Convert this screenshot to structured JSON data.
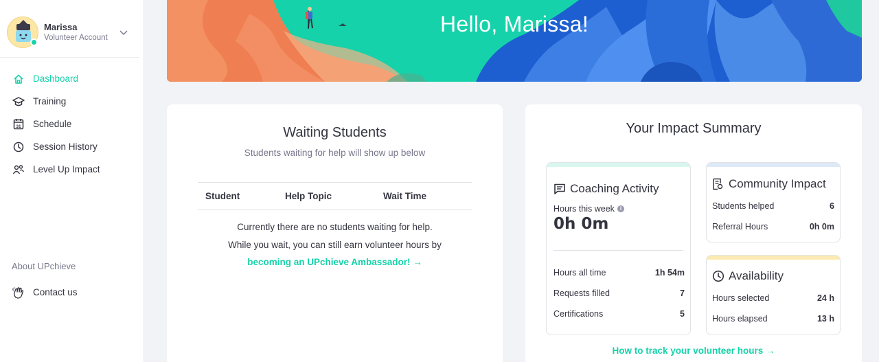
{
  "profile": {
    "name": "Marissa",
    "role": "Volunteer Account"
  },
  "nav": {
    "items": [
      {
        "label": "Dashboard",
        "icon": "home-icon",
        "active": true
      },
      {
        "label": "Training",
        "icon": "graduation-cap-icon"
      },
      {
        "label": "Schedule",
        "icon": "calendar-icon",
        "day": "31"
      },
      {
        "label": "Session History",
        "icon": "clock-icon"
      },
      {
        "label": "Level Up Impact",
        "icon": "people-icon"
      }
    ],
    "about_label": "About UPchieve",
    "contact_label": "Contact us"
  },
  "banner": {
    "title": "Hello, Marissa!"
  },
  "waiting": {
    "title": "Waiting Students",
    "subtitle": "Students waiting for help will show up below",
    "columns": [
      "Student",
      "Help Topic",
      "Wait Time"
    ],
    "empty_line1": "Currently there are no students waiting for help.",
    "empty_line2": "While you wait, you can still earn volunteer hours by",
    "ambassador_link": "becoming an UPchieve Ambassador! →"
  },
  "impact": {
    "title": "Your Impact Summary",
    "coaching": {
      "title": "Coaching Activity",
      "hours_week_label": "Hours this week",
      "hours_week_value": "0h 0m",
      "rows": [
        {
          "label": "Hours all time",
          "value": "1h 54m"
        },
        {
          "label": "Requests filled",
          "value": "7"
        },
        {
          "label": "Certifications",
          "value": "5"
        }
      ]
    },
    "community": {
      "title": "Community Impact",
      "rows": [
        {
          "label": "Students helped",
          "value": "6"
        },
        {
          "label": "Referral Hours",
          "value": "0h 0m"
        }
      ]
    },
    "availability": {
      "title": "Availability",
      "rows": [
        {
          "label": "Hours selected",
          "value": "24 h"
        },
        {
          "label": "Hours elapsed",
          "value": "13 h"
        }
      ]
    },
    "track_link": "How to track your volunteer hours →"
  },
  "colors": {
    "accent": "#16d2aa",
    "text": "#343440",
    "muted": "#77778b",
    "coaching_bar": "#d9f6ee",
    "community_bar": "#dde9f7",
    "availability_bar": "#fbeab2"
  }
}
